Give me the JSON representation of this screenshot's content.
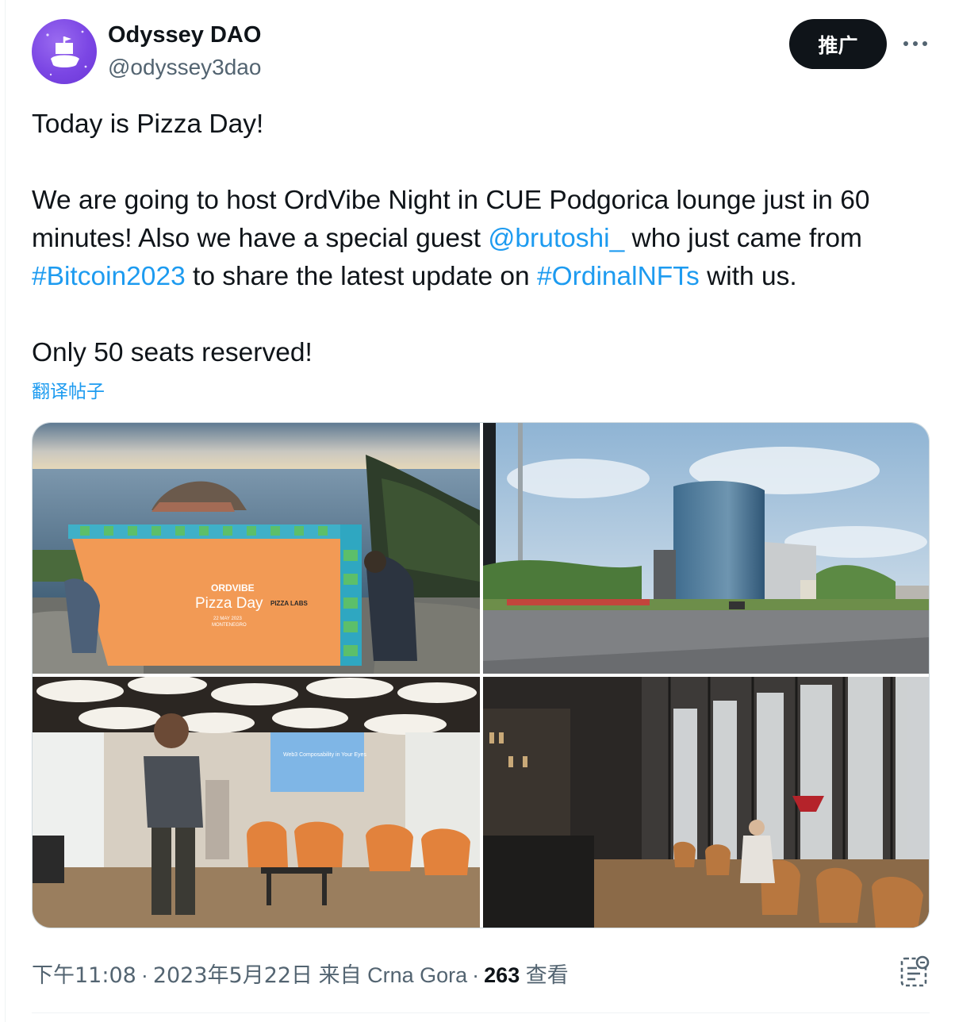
{
  "author": {
    "display_name": "Odyssey DAO",
    "handle": "@odyssey3dao",
    "avatar_icon": "ship-logo-icon",
    "avatar_color": "#7b46e4"
  },
  "header": {
    "promo_label": "推广",
    "more_icon": "more-horizontal-icon"
  },
  "tweet": {
    "line1": "Today is Pizza Day!",
    "p2_before_mention": "We are going to host OrdVibe Night in CUE Podgorica lounge just in 60 minutes! Also we have a special guest ",
    "mention": "@brutoshi_",
    "p2_after_mention": " who just came from ",
    "hashtag1": "#Bitcoin2023",
    "p2_middle": " to share the latest update on ",
    "hashtag2": "#OrdinalNFTs",
    "p2_end": " with us.",
    "line3": "Only 50 seats reserved!",
    "translate_label": "翻译帖子",
    "link_color": "#1d9bf0"
  },
  "media": {
    "banner_title": "ORDVIBE",
    "banner_subtitle": "Pizza Day",
    "banner_date": "22 MAY 2023",
    "banner_place": "MONTENEGRO",
    "banner_pizza_labs": "PIZZA LABS",
    "screen_text": "Web3 Composability in Your Eyes"
  },
  "footer": {
    "time": "下午11:08",
    "separator": "·",
    "date": "2023年5月22日",
    "source_prefix": "来自",
    "location": "Crna Gora",
    "views_count": "263",
    "views_label": "查看",
    "analytics_icon": "analytics-icon"
  }
}
